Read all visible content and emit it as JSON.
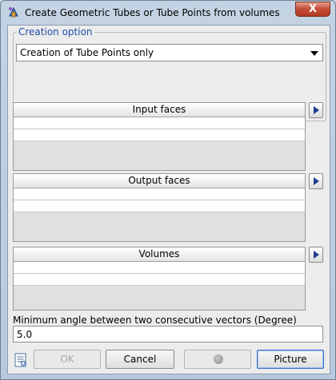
{
  "window": {
    "title": "Create Geometric Tubes or Tube Points from volumes",
    "close_label": "X"
  },
  "creation_option": {
    "legend": "Creation option",
    "selected": "Creation of Tube Points only"
  },
  "lists": {
    "input_faces": {
      "header": "Input faces"
    },
    "output_faces": {
      "header": "Output faces"
    },
    "volumes": {
      "header": "Volumes"
    }
  },
  "angle": {
    "label": "Minimum angle between two consecutive vectors (Degree)",
    "value": "5.0"
  },
  "buttons": {
    "ok": "OK",
    "cancel": "Cancel",
    "picture": "Picture"
  },
  "icons": {
    "app": "tube-app-icon",
    "help": "help-document-icon",
    "add": "triangle-right-icon",
    "record": "record-dot-icon",
    "dropdown": "chevron-down-icon"
  },
  "colors": {
    "legend": "#1f4fa8",
    "close": "#c44a33",
    "arrow": "#1d3d8f"
  }
}
